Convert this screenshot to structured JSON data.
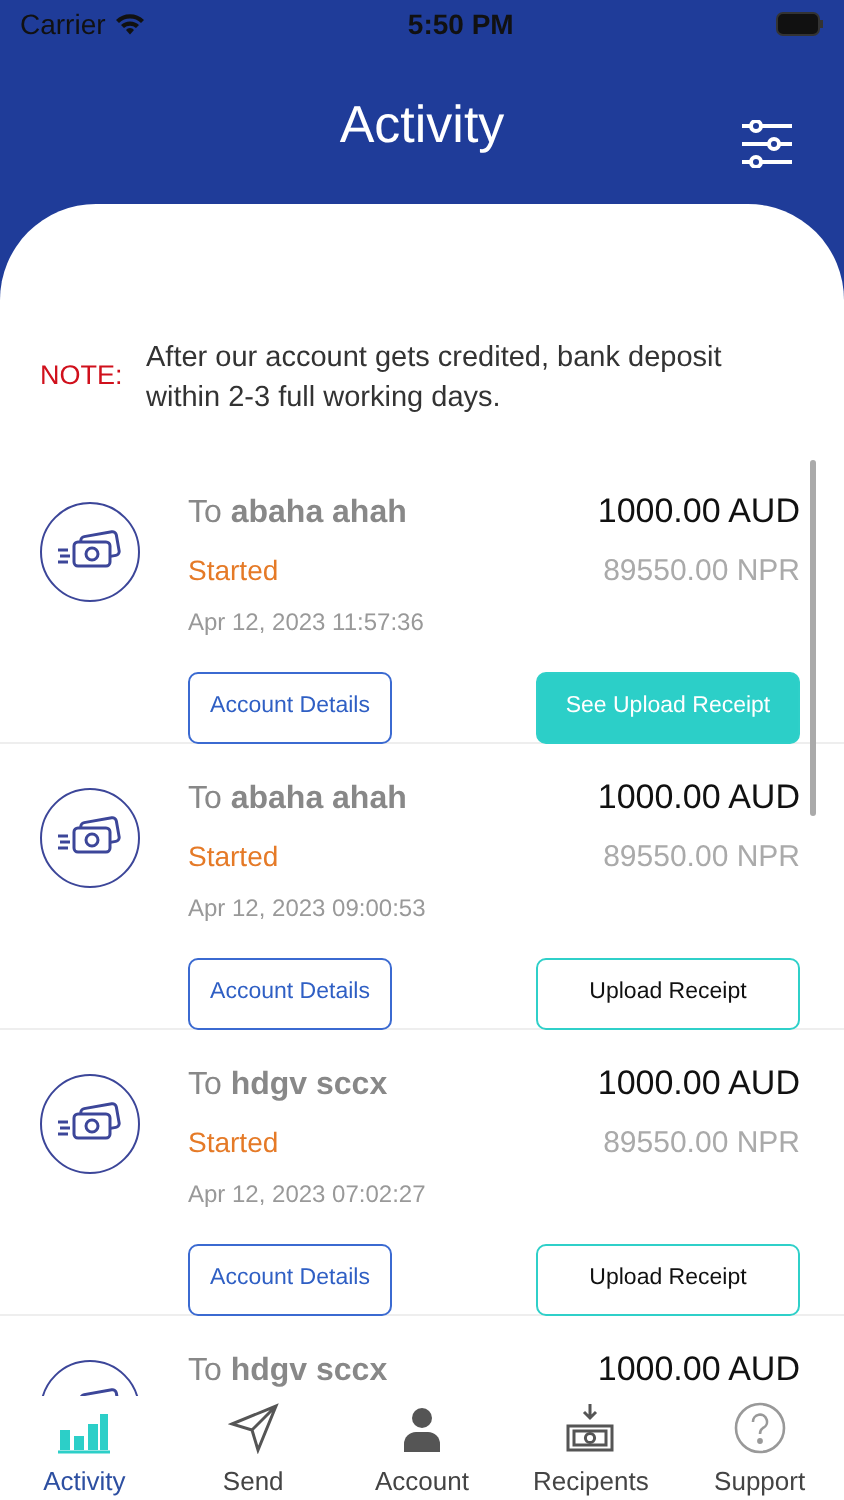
{
  "status_bar": {
    "carrier": "Carrier",
    "time": "5:50 PM"
  },
  "header": {
    "title": "Activity"
  },
  "note": {
    "label": "NOTE:",
    "text": "After our account gets credited, bank deposit within 2-3 full working days."
  },
  "transactions": [
    {
      "recipient": "To **abaha ahah**",
      "amount": "1000.00 AUD",
      "status": "Started",
      "converted": "89550.00 NPR",
      "date": "Apr 12, 2023 11:57:36",
      "details_button": "Account Details",
      "receipt_button": "See Upload Receipt",
      "receipt_uploaded": true
    },
    {
      "recipient": "To **abaha ahah**",
      "amount": "1000.00 AUD",
      "status": "Started",
      "converted": "89550.00 NPR",
      "date": "Apr 12, 2023 09:00:53",
      "details_button": "Account Details",
      "receipt_button": "Upload Receipt",
      "receipt_uploaded": false
    },
    {
      "recipient": "To **hdgv sccx**",
      "amount": "1000.00 AUD",
      "status": "Started",
      "converted": "89550.00 NPR",
      "date": "Apr 12, 2023 07:02:27",
      "details_button": "Account Details",
      "receipt_button": "Upload Receipt",
      "receipt_uploaded": false
    },
    {
      "recipient": "To **hdgv sccx**",
      "amount": "1000.00 AUD"
    }
  ],
  "tab_bar": [
    {
      "kind": "activity",
      "label": "Activity",
      "selected": true
    },
    {
      "kind": "send",
      "label": "Send",
      "selected": false
    },
    {
      "kind": "account",
      "label": "Account",
      "selected": false
    },
    {
      "kind": "recipients",
      "label": "Recipents",
      "selected": false
    },
    {
      "kind": "support",
      "label": "Support",
      "selected": false
    }
  ]
}
